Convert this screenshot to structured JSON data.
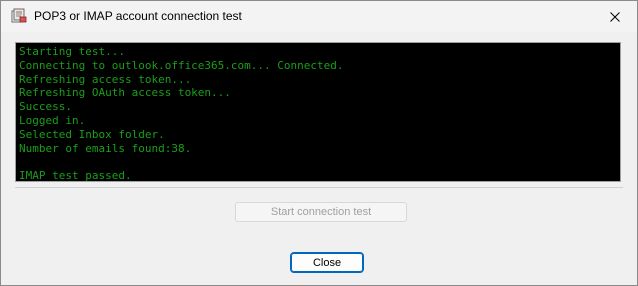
{
  "window": {
    "title": "POP3 or IMAP account connection test",
    "icon": "mail-test-icon",
    "close_glyph": "✕"
  },
  "console": {
    "lines": [
      "Starting test...",
      "Connecting to outlook.office365.com... Connected.",
      "Refreshing access token...",
      "Refreshing OAuth access token...",
      "Success.",
      "Logged in.",
      "Selected Inbox folder.",
      "Number of emails found:38.",
      "",
      "IMAP test passed."
    ],
    "text_color": "#1a9e1a",
    "background_color": "#000000"
  },
  "buttons": {
    "start_test_label": "Start connection test",
    "start_test_enabled": false,
    "close_label": "Close"
  }
}
